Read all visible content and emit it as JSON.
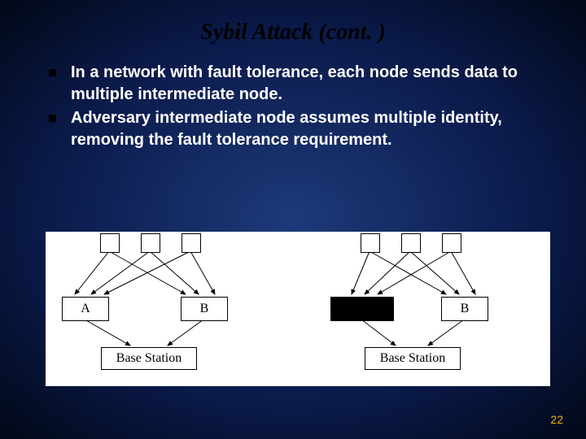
{
  "title": "Sybil Attack (cont. )",
  "bullets": [
    "In a network with fault tolerance, each node sends data to multiple intermediate node.",
    "Adversary intermediate node assumes multiple identity, removing the fault tolerance requirement."
  ],
  "diagram": {
    "left": {
      "top_nodes": [
        "",
        "",
        ""
      ],
      "mid_nodes": [
        "A",
        "B"
      ],
      "base": "Base Station"
    },
    "right": {
      "top_nodes": [
        "",
        "",
        ""
      ],
      "mid_nodes_black": "",
      "mid_nodes_right": "B",
      "base": "Base Station"
    }
  },
  "page_number": "22"
}
